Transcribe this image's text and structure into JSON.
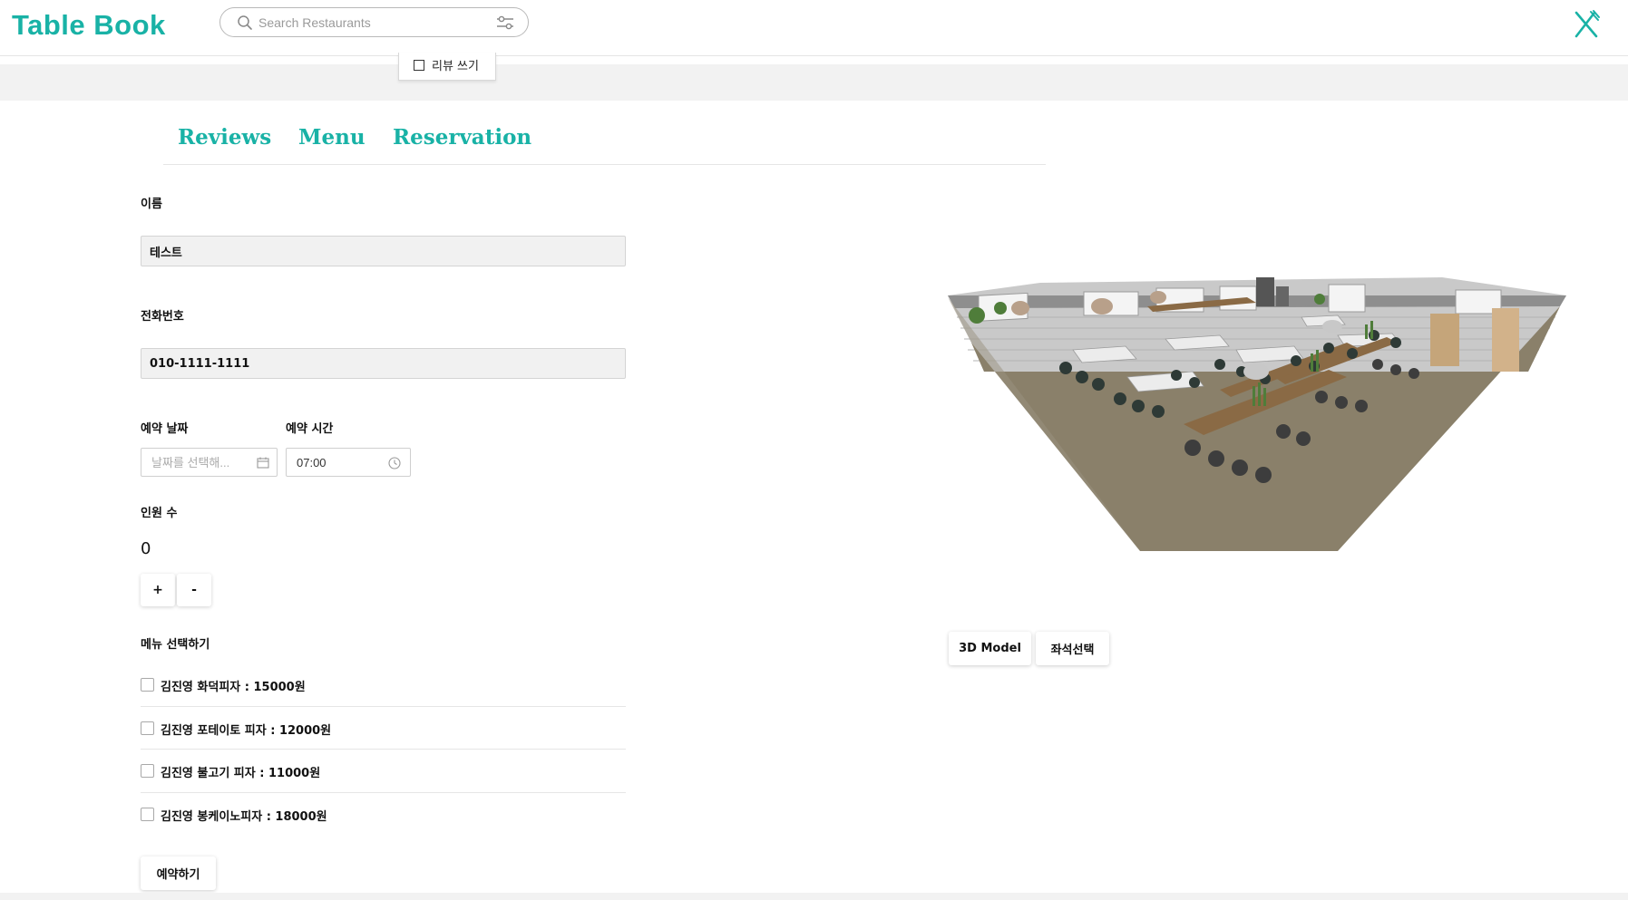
{
  "app": {
    "brand": "Table Book"
  },
  "header": {
    "search_placeholder": "Search Restaurants",
    "search_icon": "search-icon",
    "filter_icon": "filter-icon",
    "menu_icon": "utensils-icon"
  },
  "band": {
    "button_label": "리뷰 쓰기"
  },
  "tabs": [
    {
      "label": "Reviews"
    },
    {
      "label": "Menu"
    },
    {
      "label": "Reservation"
    }
  ],
  "form": {
    "name_label": "이름",
    "name_value": "테스트",
    "phone_label": "전화번호",
    "phone_value": "010-1111-1111",
    "date_label": "예약 날짜",
    "date_placeholder": "날짜를 선택해...",
    "time_label": "예약 시간",
    "time_value": "07:00",
    "people_label": "인원 수",
    "people_count": "0",
    "plus_label": "+",
    "minus_label": "-",
    "menu_label": "메뉴 선택하기",
    "menu_items": [
      {
        "label": "김진영 화덕피자 : 15000원",
        "checked": false
      },
      {
        "label": "김진영 포테이토 피자 : 12000원",
        "checked": false
      },
      {
        "label": "김진영 불고기 피자 : 11000원",
        "checked": false
      },
      {
        "label": "김진영 봉케이노피자 : 18000원",
        "checked": false
      }
    ],
    "submit_label": "예약하기"
  },
  "model": {
    "btn_3d": "3D Model",
    "btn_seat": "좌석선택"
  },
  "colors": {
    "accent": "#19b2a6",
    "band": "#f2f2f2",
    "field_bg": "#f1f1f1"
  }
}
